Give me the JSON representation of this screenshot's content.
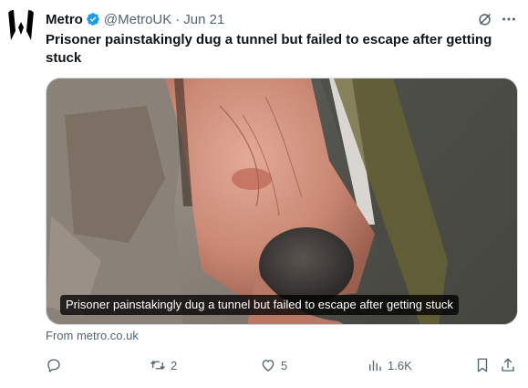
{
  "account": {
    "display_name": "Metro",
    "handle": "@MetroUK",
    "separator": "·",
    "time": "Jun 21"
  },
  "icons": {
    "verified": "verified-badge-icon",
    "grok": "grok-icon",
    "more": "more-icon",
    "reply": "reply-icon",
    "retweet": "retweet-icon",
    "like": "like-icon",
    "views": "views-icon",
    "bookmark": "bookmark-icon",
    "share": "share-icon"
  },
  "tweet": {
    "text": "Prisoner painstakingly dug a tunnel but failed to escape after getting stuck"
  },
  "media": {
    "caption": "Prisoner painstakingly dug a tunnel but failed to escape after getting stuck"
  },
  "card": {
    "source": "From metro.co.uk"
  },
  "actions": {
    "retweets": "2",
    "likes": "5",
    "views": "1.6K"
  },
  "colors": {
    "verified": "#1d9bf0",
    "text_primary": "#0f1419",
    "text_secondary": "#536471"
  }
}
